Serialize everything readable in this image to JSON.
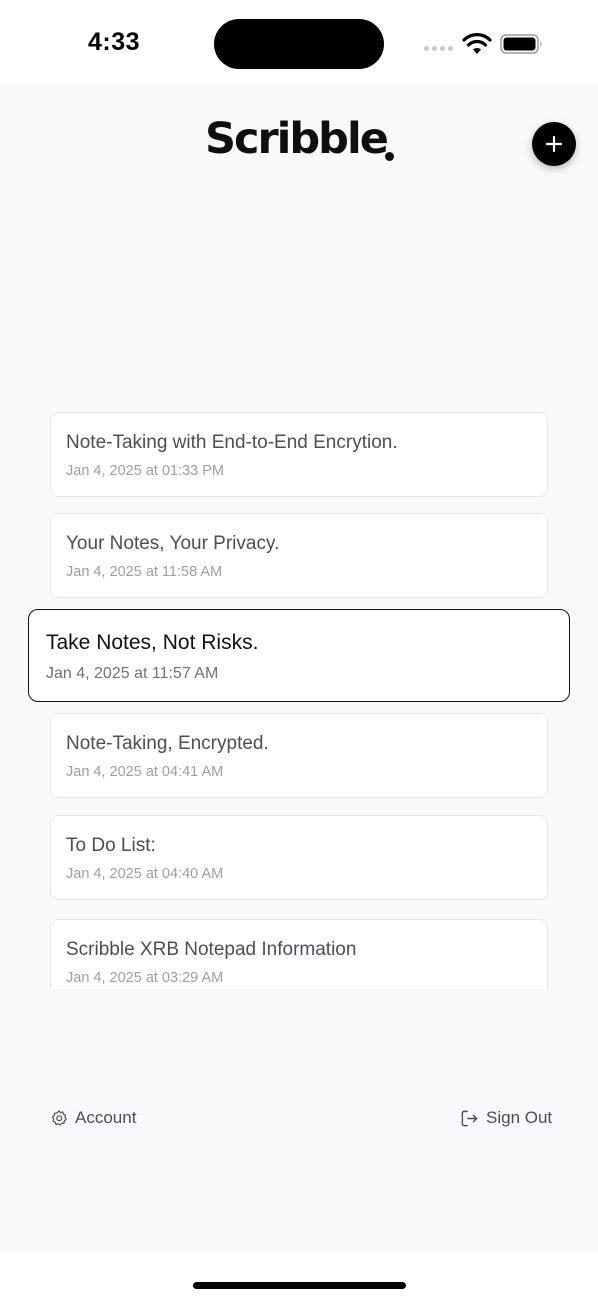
{
  "status_bar": {
    "time": "4:33"
  },
  "header": {
    "logo_text": "Scribble",
    "add_icon": "plus-icon"
  },
  "notes": [
    {
      "title": "Note-Taking with End-to-End Encrytion.",
      "date": "Jan 4, 2025 at 01:33 PM",
      "active": false
    },
    {
      "title": "Your Notes, Your Privacy.",
      "date": "Jan 4, 2025 at 11:58 AM",
      "active": false
    },
    {
      "title": "Take Notes, Not Risks.",
      "date": "Jan 4, 2025 at 11:57 AM",
      "active": true
    },
    {
      "title": "Note-Taking, Encrypted.",
      "date": "Jan 4, 2025 at 04:41 AM",
      "active": false
    },
    {
      "title": "To Do List:",
      "date": "Jan 4, 2025 at 04:40 AM",
      "active": false
    },
    {
      "title": "Scribble XRB Notepad Information",
      "date": "Jan 4, 2025 at 03:29 AM",
      "active": false
    }
  ],
  "footer": {
    "account_label": "Account",
    "account_icon": "gear-icon",
    "signout_label": "Sign Out",
    "signout_icon": "sign-out-icon"
  },
  "colors": {
    "background": "#f7f9fb",
    "accent": "#000000",
    "card_border": "#e5e7eb"
  }
}
